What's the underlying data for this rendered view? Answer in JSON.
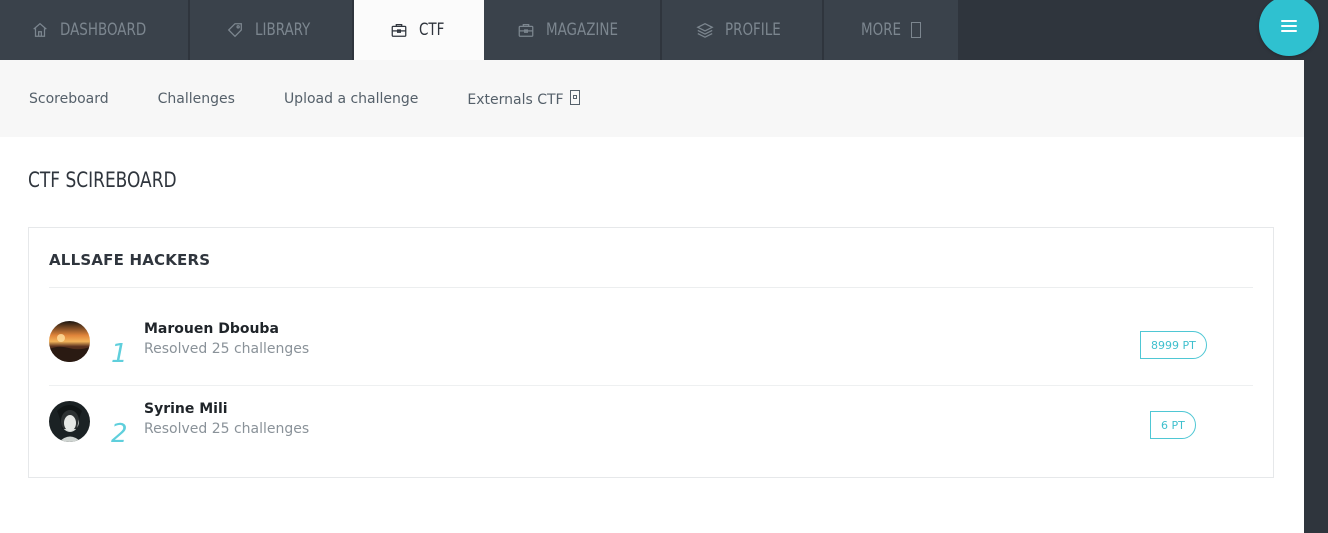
{
  "nav": {
    "tabs": [
      {
        "label": "DASHBOARD",
        "icon": "home-icon"
      },
      {
        "label": "LIBRARY",
        "icon": "tag-icon"
      },
      {
        "label": "CTF",
        "icon": "briefcase-icon",
        "active": true
      },
      {
        "label": "MAGAZINE",
        "icon": "briefcase-icon"
      },
      {
        "label": "PROFILE",
        "icon": "layers-icon"
      },
      {
        "label": "MORE",
        "icon": "external-icon"
      }
    ]
  },
  "menu_button": {
    "icon": "hamburger-icon"
  },
  "subnav": {
    "items": [
      "Scoreboard",
      "Challenges",
      "Upload a challenge",
      "Externals CTF"
    ]
  },
  "page": {
    "title": "CTF SCIREBOARD"
  },
  "scoreboard": {
    "team": "ALLSAFE HACKERS",
    "entries": [
      {
        "rank": "1",
        "name": "Marouen Dbouba",
        "detail": "Resolved 25 challenges",
        "points": "8999 PT"
      },
      {
        "rank": "2",
        "name": "Syrine Mili",
        "detail": "Resolved 25 challenges",
        "points": "6 PT"
      }
    ]
  },
  "colors": {
    "accent": "#2fc1d0",
    "nav_bg": "#3a424b",
    "dark_bg": "#2f353d"
  }
}
